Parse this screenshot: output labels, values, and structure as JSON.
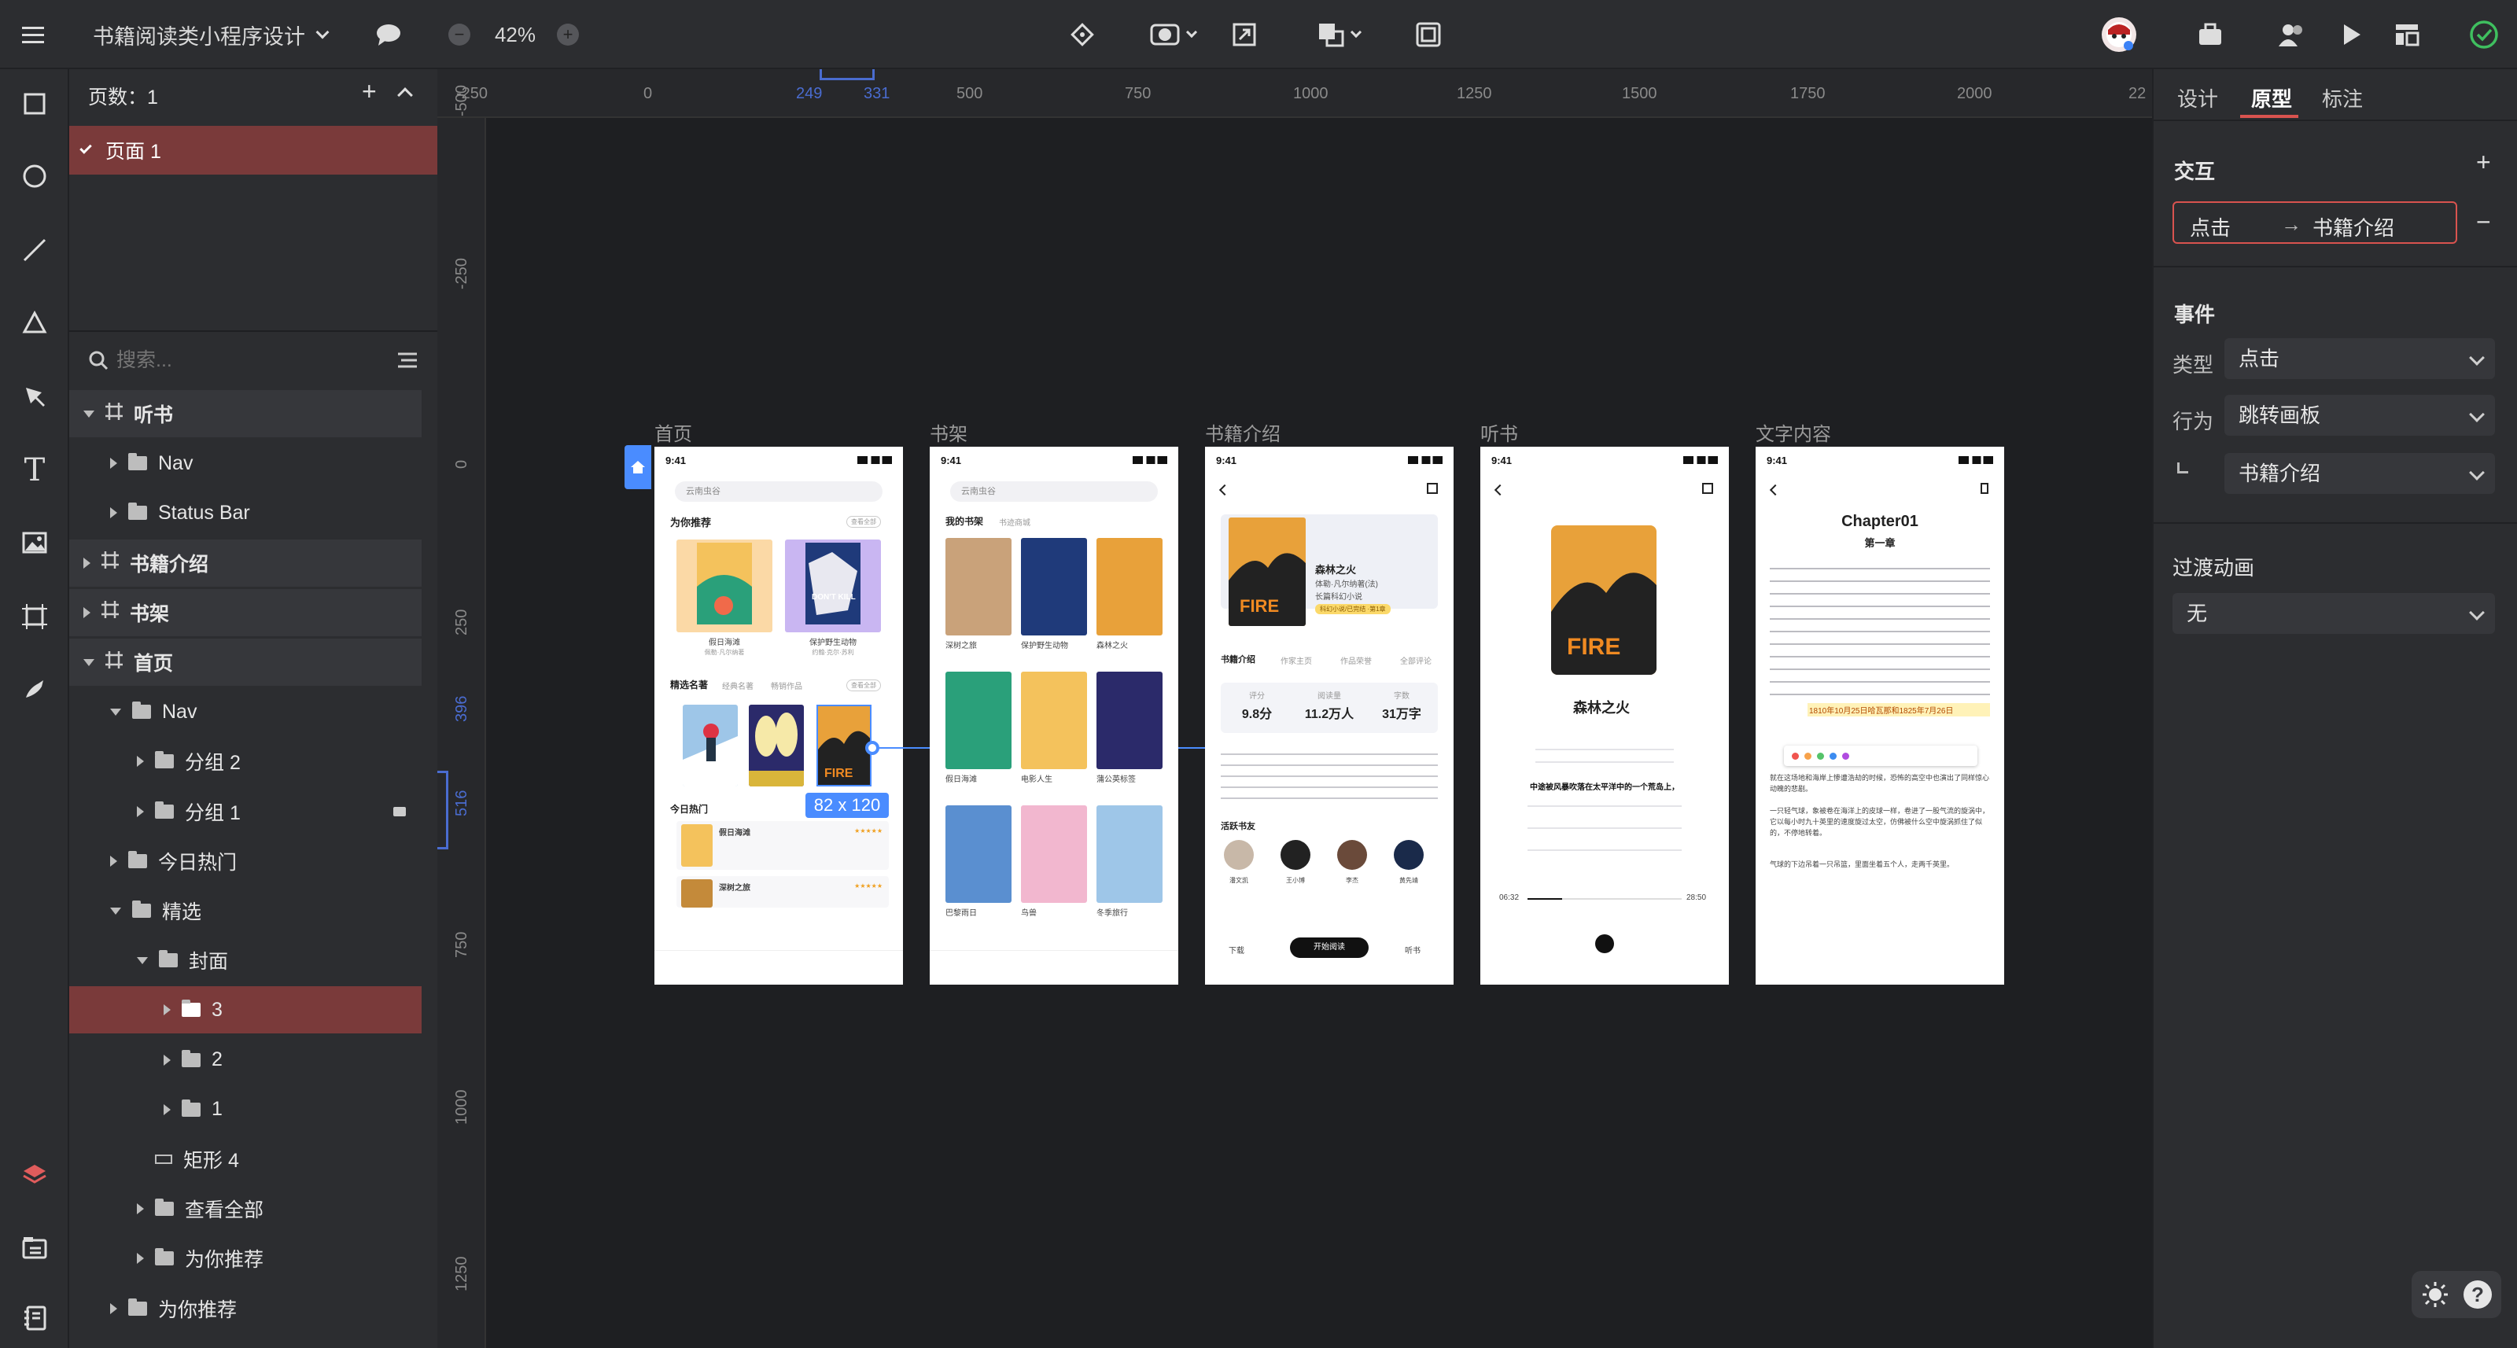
{
  "file": {
    "title": "书籍阅读类小程序设计",
    "zoom": "42%"
  },
  "layers": {
    "pages_label": "页数：1",
    "page_item": "页面 1",
    "search_placeholder": "搜索...",
    "tree": [
      {
        "label": "听书",
        "depth": 0,
        "open": true,
        "kind": "frame"
      },
      {
        "label": "Nav",
        "depth": 1,
        "open": false,
        "kind": "folder"
      },
      {
        "label": "Status Bar",
        "depth": 1,
        "open": false,
        "kind": "folder"
      },
      {
        "label": "书籍介绍",
        "depth": 0,
        "open": false,
        "kind": "frame"
      },
      {
        "label": "书架",
        "depth": 0,
        "open": false,
        "kind": "frame"
      },
      {
        "label": "首页",
        "depth": 0,
        "open": true,
        "kind": "frame"
      },
      {
        "label": "Nav",
        "depth": 1,
        "open": true,
        "kind": "folder"
      },
      {
        "label": "分组 2",
        "depth": 2,
        "open": false,
        "kind": "folder"
      },
      {
        "label": "分组 1",
        "depth": 2,
        "open": false,
        "kind": "folder",
        "locked": true
      },
      {
        "label": "今日热门",
        "depth": 1,
        "open": false,
        "kind": "folder"
      },
      {
        "label": "精选",
        "depth": 1,
        "open": true,
        "kind": "folder"
      },
      {
        "label": "封面",
        "depth": 2,
        "open": true,
        "kind": "folder"
      },
      {
        "label": "3",
        "depth": 3,
        "open": false,
        "kind": "folder",
        "selected": true
      },
      {
        "label": "2",
        "depth": 3,
        "open": false,
        "kind": "folder"
      },
      {
        "label": "1",
        "depth": 3,
        "open": false,
        "kind": "folder"
      },
      {
        "label": "矩形 4",
        "depth": 2,
        "open": false,
        "kind": "rect"
      },
      {
        "label": "查看全部",
        "depth": 2,
        "open": false,
        "kind": "folder"
      },
      {
        "label": "为你推荐",
        "depth": 2,
        "open": false,
        "kind": "folder"
      },
      {
        "label": "为你推荐",
        "depth": 1,
        "open": false,
        "kind": "folder"
      }
    ]
  },
  "rulers": {
    "h": [
      "-250",
      "0",
      "249",
      "331",
      "500",
      "750",
      "1000",
      "1250",
      "1500",
      "1750",
      "2000",
      "22"
    ],
    "v": [
      "-500",
      "-250",
      "0",
      "250",
      "396",
      "516",
      "750",
      "1000",
      "1250"
    ]
  },
  "artboards": {
    "labels": [
      "首页",
      "书架",
      "书籍介绍",
      "听书",
      "文字内容"
    ],
    "selection_size": "82 x 120",
    "home": {
      "time": "9:41",
      "search": "云南虫谷",
      "rec": "为你推荐",
      "more": "查看全部",
      "b1": "假日海滩",
      "b1a": "佩勒·凡尔纳著",
      "b2": "保护野生动物",
      "b2a": "约翰·克尔·苏利",
      "tabs": [
        "精选名著",
        "经典名著",
        "畅销作品"
      ],
      "hot": "今日热门",
      "h1": "假日海滩",
      "h2": "深树之旅"
    },
    "shelf": {
      "time": "9:41",
      "search": "云南虫谷",
      "tab1": "我的书架",
      "tab2": "书迹商城",
      "books": [
        "深树之旅",
        "保护野生动物",
        "森林之火",
        "假日海滩",
        "电影人生",
        "蒲公英标签",
        "巴黎雨日",
        "鸟兽",
        "冬季旅行"
      ]
    },
    "intro": {
      "time": "9:41",
      "title": "森林之火",
      "author": "体勒·凡尔纳著(法)",
      "genre": "长篇科幻小说",
      "tag": "科幻小说/已完结 ·第1章",
      "tabs": [
        "书籍介绍",
        "作家主页",
        "作品荣誉",
        "全部评论"
      ],
      "stats": [
        {
          "label": "评分",
          "value": "9.8",
          "unit": "分"
        },
        {
          "label": "阅读量",
          "value": "11.2",
          "unit": "万人"
        },
        {
          "label": "字数",
          "value": "31",
          "unit": "万字"
        }
      ],
      "fans": "活跃书友",
      "readers": [
        "潘文凯",
        "王小博",
        "李杰",
        "黄先靖"
      ],
      "download": "下载",
      "read": "开始阅读",
      "listen": "听书"
    },
    "listen": {
      "time": "9:41",
      "title": "森林之火",
      "highlight": "中途被风暴吹落在太平洋中的一个荒岛上，",
      "elapsed": "06:32",
      "total": "28:50"
    },
    "text": {
      "time": "9:41",
      "chapter": "Chapter01",
      "section": "第一章",
      "dates": "1810年10月25日哈瓦那和1825年7月26日",
      "p2": "就在这场地和海岸上惨遭浩劫的时候，恐怖的高空中也演出了同样惊心动魄的悲剧。",
      "p3": "一只轻气球，象被卷在海洋上的皮球一样，卷进了一股气流的旋涡中，它以每小时九十英里的速度旋过太空，仿佛被什么空中旋涡抓住了似的，不停地转着。",
      "p4": "气球的下边吊着一只吊篮，里面坐着五个人，走两千英里。"
    }
  },
  "panel": {
    "tabs": [
      "设计",
      "原型",
      "标注"
    ],
    "active_tab": "原型",
    "interaction_h": "交互",
    "interaction": {
      "trigger": "点击",
      "target": "书籍介绍"
    },
    "event_h": "事件",
    "type_label": "类型",
    "type_value": "点击",
    "action_label": "行为",
    "action_value": "跳转画板",
    "target_value": "书籍介绍",
    "transition_h": "过渡动画",
    "transition_value": "无"
  },
  "colors": {
    "accent": "#d9534f",
    "selection": "#4a8cff",
    "bg": "#1e1f22",
    "panel": "#2c2d30"
  }
}
